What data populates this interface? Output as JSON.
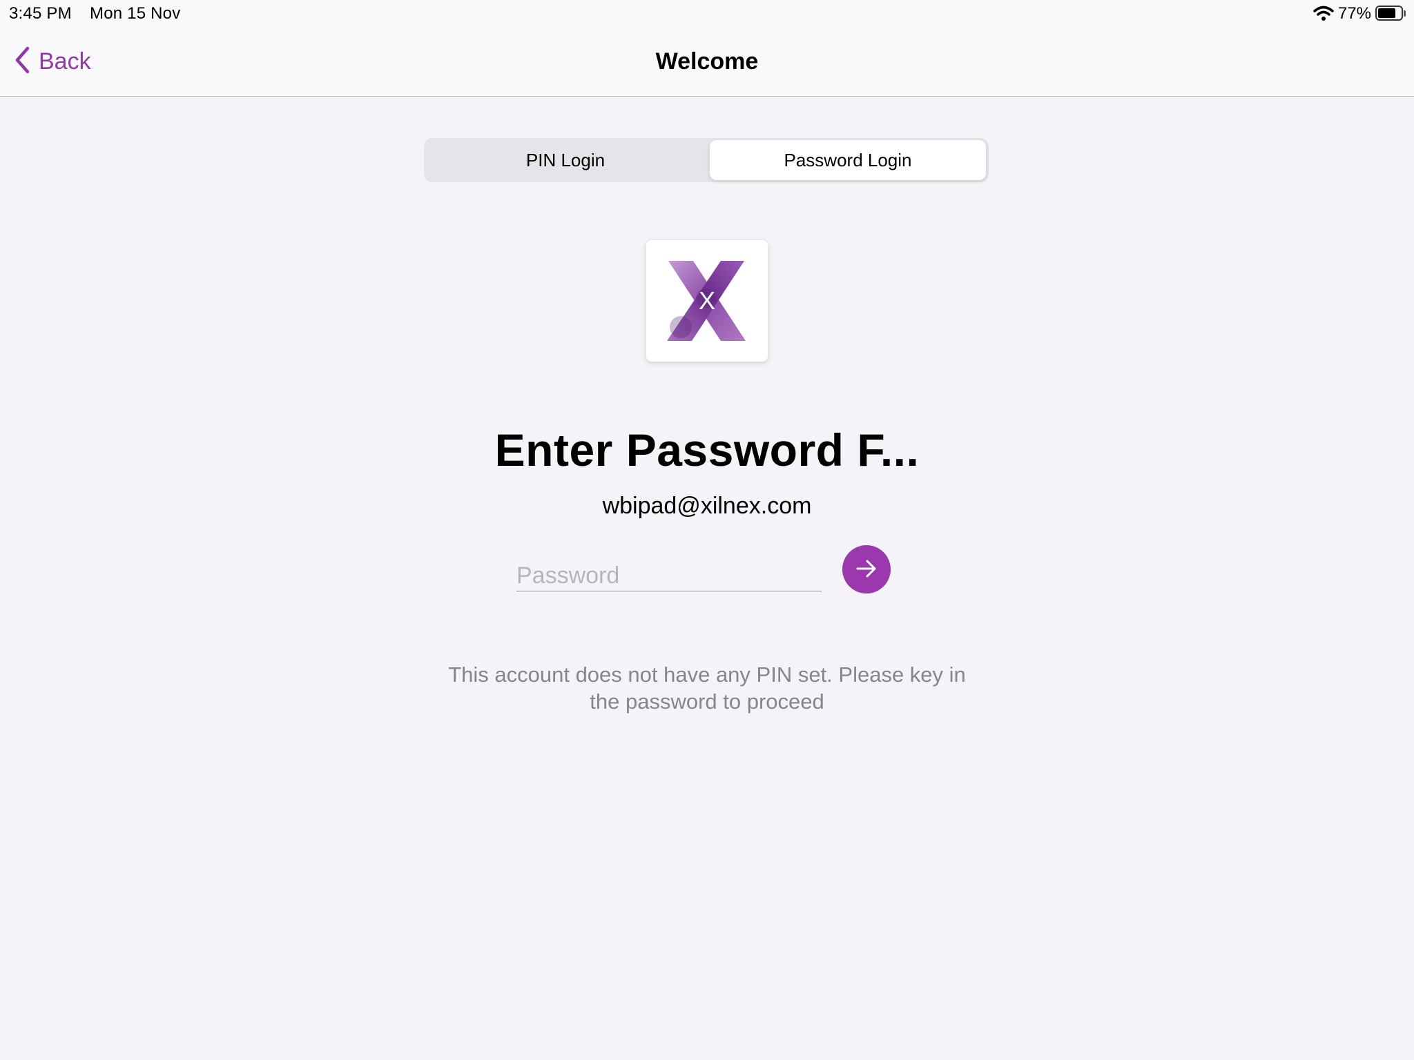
{
  "status_bar": {
    "time": "3:45 PM",
    "date": "Mon 15 Nov",
    "battery_percent_label": "77%",
    "battery_level": 0.77,
    "icons": [
      "wifi-icon",
      "battery-icon"
    ]
  },
  "nav": {
    "back_label": "Back",
    "back_icon": "chevron-left-icon",
    "title": "Welcome"
  },
  "segments": {
    "pin_label": "PIN Login",
    "password_label": "Password Login",
    "selected": "Password Login"
  },
  "logo": {
    "letter": "X",
    "icon": "xilnex-logo-icon"
  },
  "login": {
    "heading": "Enter Password F...",
    "email": "wbipad@xilnex.com",
    "password_value": "",
    "password_placeholder": "Password",
    "submit_icon": "arrow-right-icon",
    "info": "This account does not have any PIN set. Please key in the password to proceed"
  },
  "colors": {
    "accent": "#9b38ad",
    "back_tint": "#8e3aa3",
    "background": "#f3f3f8",
    "secondary_text": "#85858b"
  }
}
